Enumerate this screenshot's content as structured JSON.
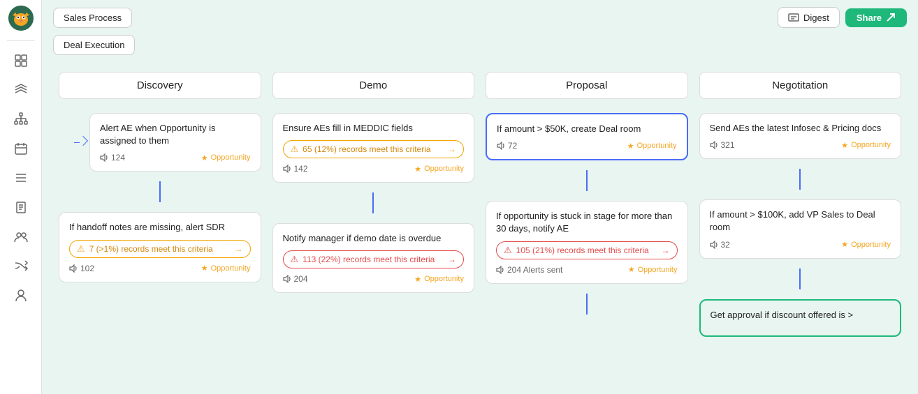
{
  "app": {
    "title": "Sales Process"
  },
  "header": {
    "tabs": [
      "Sales Process",
      "Deal Execution"
    ],
    "digest_label": "Digest",
    "share_label": "Share"
  },
  "columns": [
    {
      "id": "discovery",
      "header": "Discovery",
      "cards": [
        {
          "id": "disc-1",
          "title": "Alert AE when Opportunity is assigned to them",
          "count": "124",
          "tag": "Opportunity",
          "highlighted": false
        },
        {
          "id": "disc-2",
          "title": "If handoff notes are missing, alert SDR",
          "badge_text": "7 (>1%) records meet this criteria",
          "badge_type": "orange",
          "count": "102",
          "tag": "Opportunity",
          "highlighted": false
        }
      ]
    },
    {
      "id": "demo",
      "header": "Demo",
      "cards": [
        {
          "id": "demo-1",
          "title": "Ensure AEs fill in MEDDIC fields",
          "badge_text": "65 (12%) records meet this criteria",
          "badge_type": "orange",
          "count": "142",
          "tag": "Opportunity",
          "highlighted": false
        },
        {
          "id": "demo-2",
          "title": "Notify manager if demo date is overdue",
          "badge_text": "113 (22%) records meet this criteria",
          "badge_type": "red",
          "count": "204",
          "tag": "Opportunity",
          "highlighted": false
        }
      ]
    },
    {
      "id": "proposal",
      "header": "Proposal",
      "cards": [
        {
          "id": "prop-1",
          "title": "If amount > $50K, create Deal room",
          "count": "72",
          "tag": "Opportunity",
          "highlighted": true
        },
        {
          "id": "prop-2",
          "title": "If opportunity is stuck in stage for more than 30 days, notify AE",
          "badge_text": "105 (21%) records meet this criteria",
          "badge_type": "red",
          "alerts_text": "204 Alerts sent",
          "tag": "Opportunity",
          "highlighted": false
        }
      ]
    },
    {
      "id": "negotiation",
      "header": "Negotitation",
      "cards": [
        {
          "id": "neg-1",
          "title": "Send AEs the latest Infosec & Pricing docs",
          "count": "321",
          "tag": "Opportunity",
          "highlighted": false
        },
        {
          "id": "neg-2",
          "title": "If amount > $100K, add VP Sales to Deal room",
          "count": "32",
          "tag": "Opportunity",
          "highlighted": false
        },
        {
          "id": "neg-3",
          "title": "Get approval if discount offered is >",
          "partial": true,
          "highlighted": true
        }
      ]
    }
  ],
  "icons": {
    "speaker": "📢",
    "star": "⭐",
    "share_arrow": "↗",
    "digest_icon": "📊",
    "alert_circle": "⚠",
    "arrow_right": "→",
    "layers": "▦",
    "org": "⬡",
    "calendar": "▭",
    "list": "≡",
    "clipboard": "📋",
    "group": "👥",
    "shuffle": "⇄",
    "person": "○"
  }
}
